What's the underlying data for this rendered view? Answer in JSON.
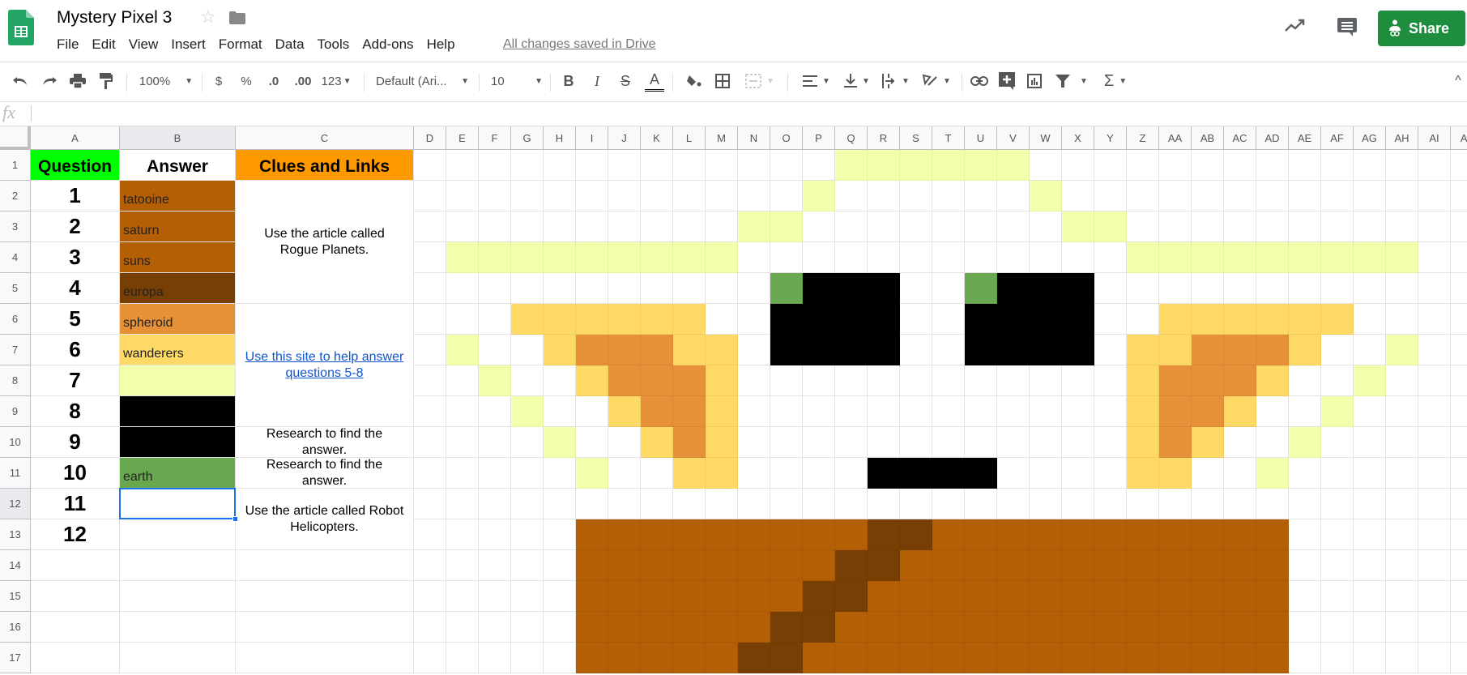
{
  "app": {
    "title": "Mystery Pixel 3",
    "saved_status": "All changes saved in Drive",
    "share_label": "Share",
    "menu": [
      "File",
      "Edit",
      "View",
      "Insert",
      "Format",
      "Data",
      "Tools",
      "Add-ons",
      "Help"
    ]
  },
  "toolbar": {
    "zoom": "100%",
    "currency": "$",
    "percent": "%",
    "decrease_decimal": ".0",
    "increase_decimal": ".00",
    "more_formats": "123",
    "font": "Default (Ari...",
    "font_size": "10",
    "bold": "B",
    "italic": "I",
    "strikethrough": "S",
    "text_color": "A",
    "sum": "Σ"
  },
  "formula_bar": {
    "fx_label": "fx",
    "value": ""
  },
  "columns": [
    "A",
    "B",
    "C",
    "D",
    "E",
    "F",
    "G",
    "H",
    "I",
    "J",
    "K",
    "L",
    "M",
    "N",
    "O",
    "P",
    "Q",
    "R",
    "S",
    "T",
    "U",
    "V",
    "W",
    "X",
    "Y",
    "Z",
    "AA",
    "AB",
    "AC",
    "AD",
    "AE",
    "AF",
    "AG",
    "AH",
    "AI",
    "AJ"
  ],
  "rows": [
    "1",
    "2",
    "3",
    "4",
    "5",
    "6",
    "7",
    "8",
    "9",
    "10",
    "11",
    "12",
    "13",
    "14",
    "15",
    "16",
    "17"
  ],
  "selected_cell": "B12",
  "header": {
    "question": "Question",
    "answer": "Answer",
    "clues": "Clues and Links"
  },
  "header_colors": {
    "question": "#00ff00",
    "answer": "#ffffff",
    "clues": "#ff9900"
  },
  "questions": [
    {
      "num": "1",
      "answer": "tatooine",
      "color": "#b45f06"
    },
    {
      "num": "2",
      "answer": "saturn",
      "color": "#b45f06"
    },
    {
      "num": "3",
      "answer": "suns",
      "color": "#b45f06"
    },
    {
      "num": "4",
      "answer": "europa",
      "color": "#783f04"
    },
    {
      "num": "5",
      "answer": "spheroid",
      "color": "#e69138"
    },
    {
      "num": "6",
      "answer": "wanderers",
      "color": "#ffd966"
    },
    {
      "num": "7",
      "answer": "",
      "color": "#f4ffab"
    },
    {
      "num": "8",
      "answer": "",
      "color": "#000000"
    },
    {
      "num": "9",
      "answer": "",
      "color": "#000000"
    },
    {
      "num": "10",
      "answer": "earth",
      "color": "#6aa84f"
    },
    {
      "num": "11",
      "answer": "",
      "color": "#ffffff"
    },
    {
      "num": "12",
      "answer": "",
      "color": "#ffffff"
    }
  ],
  "clues": [
    {
      "rows": "2-5",
      "text": "Use the article called Rogue Planets.",
      "link": false
    },
    {
      "rows": "6-9",
      "text": "Use this site to help answer questions 5-8",
      "link": true
    },
    {
      "rows": "10",
      "text": "Research to find the answer.",
      "link": false
    },
    {
      "rows": "11",
      "text": "Research to find the answer.",
      "link": false
    },
    {
      "rows": "12-13",
      "text": "Use the article called Robot Helicopters.",
      "link": false
    }
  ],
  "palette": {
    "Y": "#f4ffab",
    "G": "#ffd966",
    "O": "#e69138",
    "K": "#000000",
    "N": "#6aa84f",
    "B": "#b45f06",
    "D": "#783f04"
  },
  "pixel_art": [
    {
      "row": 1,
      "cells": {
        "Q": "Y",
        "R": "Y",
        "S": "Y",
        "T": "Y",
        "U": "Y",
        "V": "Y"
      }
    },
    {
      "row": 2,
      "cells": {
        "P": "Y",
        "W": "Y"
      }
    },
    {
      "row": 3,
      "cells": {
        "N": "Y",
        "O": "Y",
        "X": "Y",
        "Y": "Y"
      }
    },
    {
      "row": 4,
      "cells": {
        "E": "Y",
        "F": "Y",
        "G": "Y",
        "H": "Y",
        "I": "Y",
        "J": "Y",
        "K": "Y",
        "L": "Y",
        "M": "Y",
        "Z": "Y",
        "AA": "Y",
        "AB": "Y",
        "AC": "Y",
        "AD": "Y",
        "AE": "Y",
        "AF": "Y",
        "AG": "Y",
        "AH": "Y"
      }
    },
    {
      "row": 5,
      "cells": {
        "O": "N",
        "P": "K",
        "Q": "K",
        "R": "K",
        "U": "N",
        "V": "K",
        "W": "K",
        "X": "K"
      }
    },
    {
      "row": 6,
      "cells": {
        "G": "G",
        "H": "G",
        "I": "G",
        "J": "G",
        "K": "G",
        "L": "G",
        "O": "K",
        "P": "K",
        "Q": "K",
        "R": "K",
        "U": "K",
        "V": "K",
        "W": "K",
        "X": "K",
        "AA": "G",
        "AB": "G",
        "AC": "G",
        "AD": "G",
        "AE": "G",
        "AF": "G"
      }
    },
    {
      "row": 7,
      "cells": {
        "E": "Y",
        "H": "G",
        "I": "O",
        "J": "O",
        "K": "O",
        "L": "G",
        "M": "G",
        "O": "K",
        "P": "K",
        "Q": "K",
        "R": "K",
        "U": "K",
        "V": "K",
        "W": "K",
        "X": "K",
        "Z": "G",
        "AA": "G",
        "AB": "O",
        "AC": "O",
        "AD": "O",
        "AE": "G",
        "AH": "Y"
      }
    },
    {
      "row": 8,
      "cells": {
        "F": "Y",
        "I": "G",
        "J": "O",
        "K": "O",
        "L": "O",
        "M": "G",
        "Z": "G",
        "AA": "O",
        "AB": "O",
        "AC": "O",
        "AD": "G",
        "AG": "Y"
      }
    },
    {
      "row": 9,
      "cells": {
        "G": "Y",
        "J": "G",
        "K": "O",
        "L": "O",
        "M": "G",
        "Z": "G",
        "AA": "O",
        "AB": "O",
        "AC": "G",
        "AF": "Y"
      }
    },
    {
      "row": 10,
      "cells": {
        "H": "Y",
        "K": "G",
        "L": "O",
        "M": "G",
        "Z": "G",
        "AA": "O",
        "AB": "G",
        "AE": "Y"
      }
    },
    {
      "row": 11,
      "cells": {
        "I": "Y",
        "L": "G",
        "M": "G",
        "R": "K",
        "S": "K",
        "T": "K",
        "U": "K",
        "Z": "G",
        "AA": "G",
        "AD": "Y"
      }
    },
    {
      "row": 13,
      "cells": {
        "I": "B",
        "J": "B",
        "K": "B",
        "L": "B",
        "M": "B",
        "N": "B",
        "O": "B",
        "P": "B",
        "Q": "B",
        "R": "D",
        "S": "D",
        "T": "B",
        "U": "B",
        "V": "B",
        "W": "B",
        "X": "B",
        "Y": "B",
        "Z": "B",
        "AA": "B",
        "AB": "B",
        "AC": "B",
        "AD": "B"
      }
    },
    {
      "row": 14,
      "cells": {
        "I": "B",
        "J": "B",
        "K": "B",
        "L": "B",
        "M": "B",
        "N": "B",
        "O": "B",
        "P": "B",
        "Q": "D",
        "R": "D",
        "S": "B",
        "T": "B",
        "U": "B",
        "V": "B",
        "W": "B",
        "X": "B",
        "Y": "B",
        "Z": "B",
        "AA": "B",
        "AB": "B",
        "AC": "B",
        "AD": "B"
      }
    },
    {
      "row": 15,
      "cells": {
        "I": "B",
        "J": "B",
        "K": "B",
        "L": "B",
        "M": "B",
        "N": "B",
        "O": "B",
        "P": "D",
        "Q": "D",
        "R": "B",
        "S": "B",
        "T": "B",
        "U": "B",
        "V": "B",
        "W": "B",
        "X": "B",
        "Y": "B",
        "Z": "B",
        "AA": "B",
        "AB": "B",
        "AC": "B",
        "AD": "B"
      }
    },
    {
      "row": 16,
      "cells": {
        "I": "B",
        "J": "B",
        "K": "B",
        "L": "B",
        "M": "B",
        "N": "B",
        "O": "D",
        "P": "D",
        "Q": "B",
        "R": "B",
        "S": "B",
        "T": "B",
        "U": "B",
        "V": "B",
        "W": "B",
        "X": "B",
        "Y": "B",
        "Z": "B",
        "AA": "B",
        "AB": "B",
        "AC": "B",
        "AD": "B"
      }
    },
    {
      "row": 17,
      "cells": {
        "I": "B",
        "J": "B",
        "K": "B",
        "L": "B",
        "M": "B",
        "N": "D",
        "O": "D",
        "P": "B",
        "Q": "B",
        "R": "B",
        "S": "B",
        "T": "B",
        "U": "B",
        "V": "B",
        "W": "B",
        "X": "B",
        "Y": "B",
        "Z": "B",
        "AA": "B",
        "AB": "B",
        "AC": "B",
        "AD": "B"
      }
    }
  ]
}
